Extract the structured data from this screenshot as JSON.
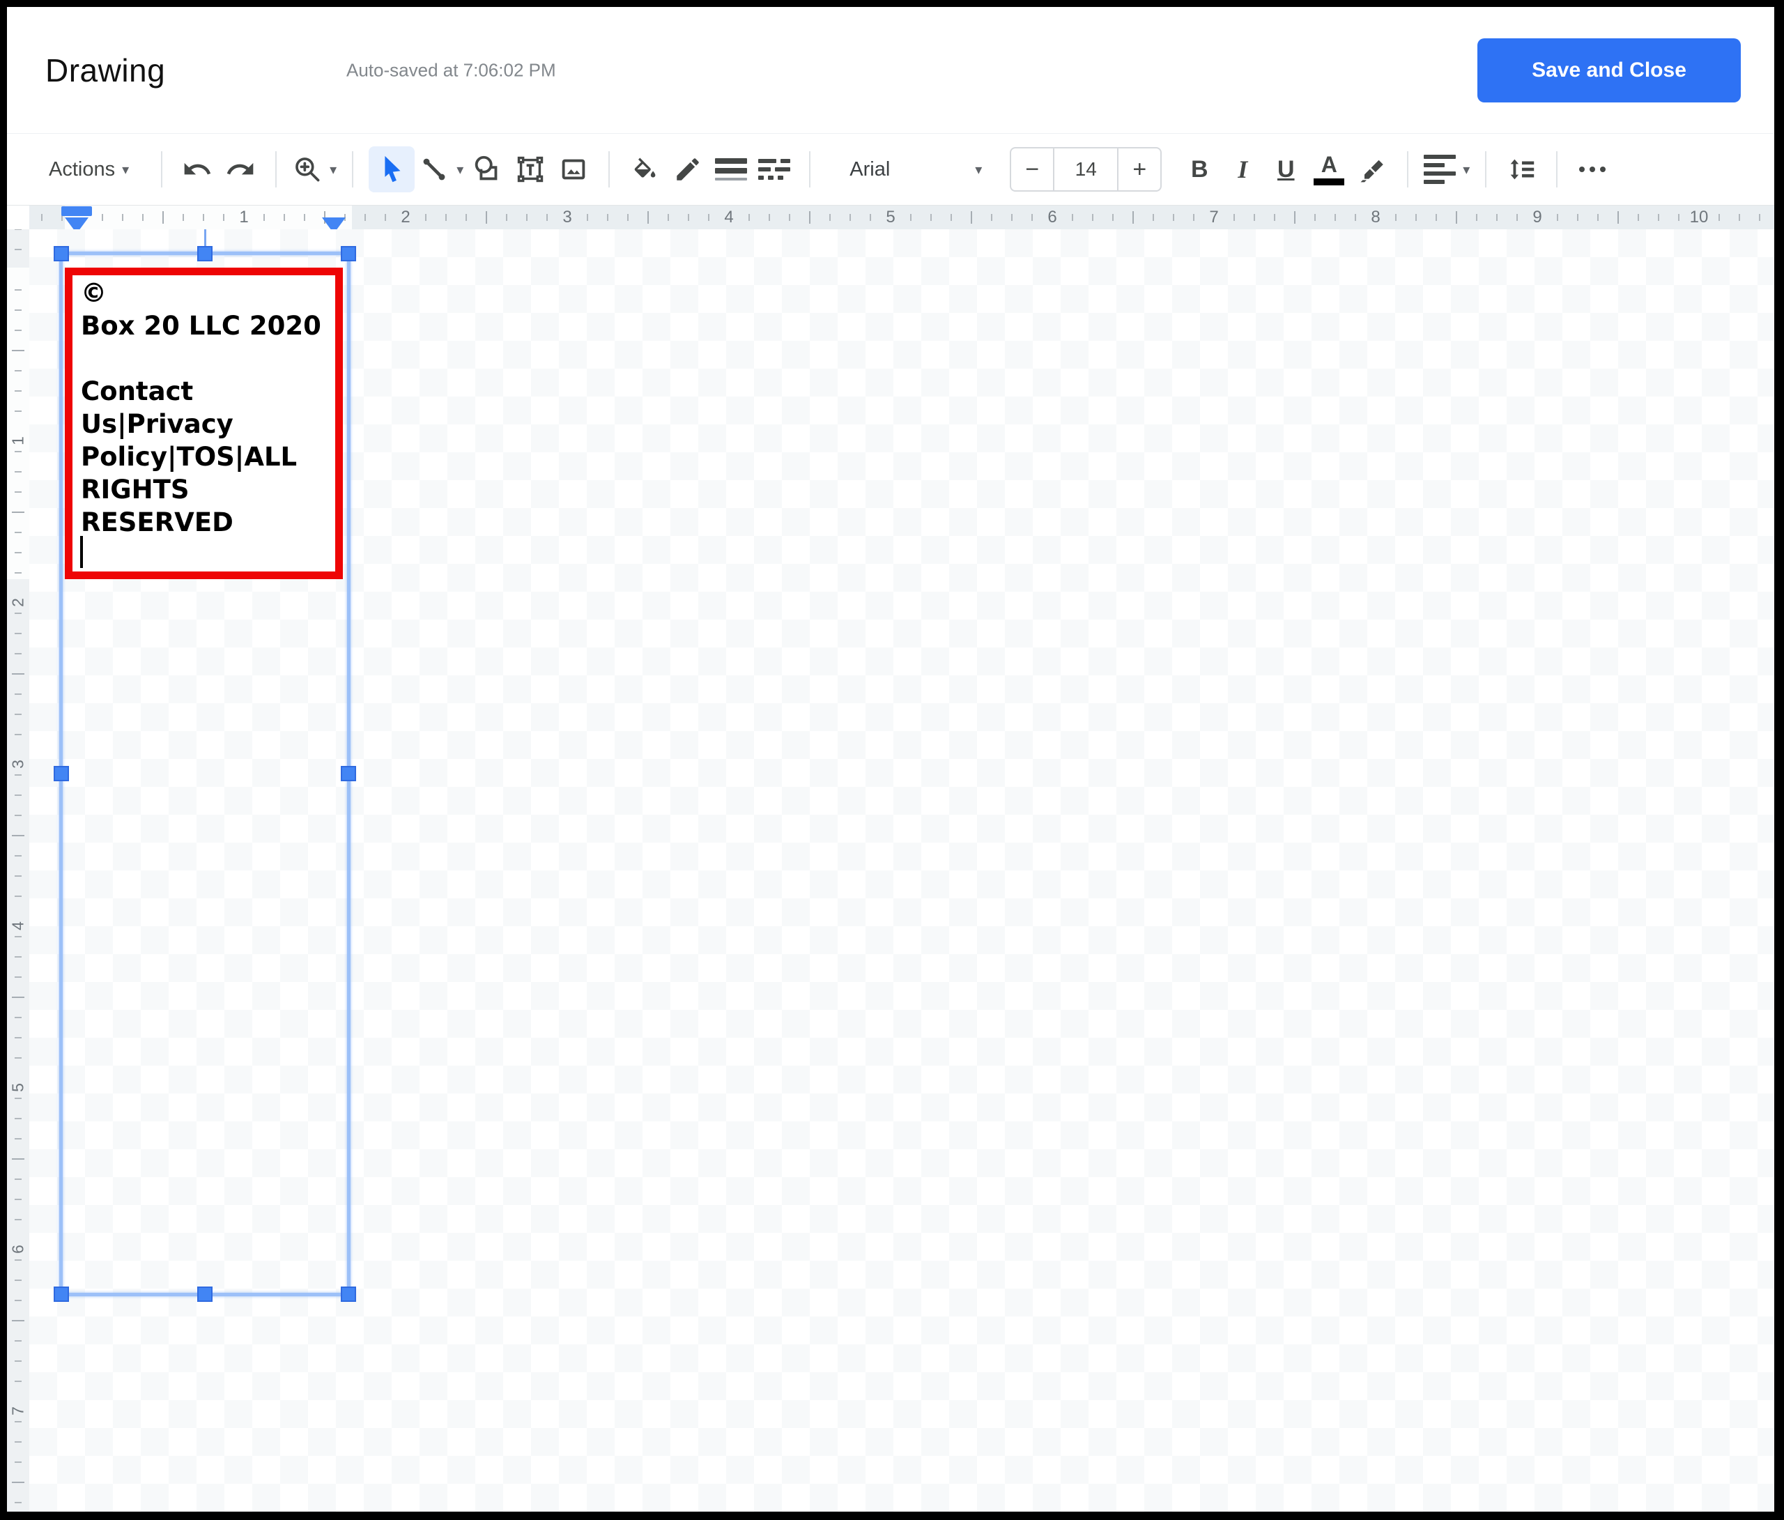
{
  "header": {
    "title": "Drawing",
    "autosave_status": "Auto-saved at 7:06:02 PM",
    "save_and_close_label": "Save and Close"
  },
  "toolbar": {
    "actions_label": "Actions",
    "caret": "▾",
    "font_name": "Arial",
    "font_size": "14",
    "decrease_label": "−",
    "increase_label": "+",
    "bold_label": "B",
    "italic_label": "I",
    "underline_label": "U",
    "text_color_label": "A"
  },
  "ruler": {
    "horizontal_numbers": [
      "1",
      "2",
      "3",
      "4",
      "5",
      "6",
      "7",
      "8",
      "9",
      "10"
    ],
    "vertical_numbers": [
      "1",
      "2",
      "3",
      "4",
      "5",
      "6",
      "7"
    ]
  },
  "canvas": {
    "textbox_text": "©\nBox 20 LLC 2020\n\nContact\nUs|Privacy\nPolicy|TOS|ALL\nRIGHTS\nRESERVED"
  },
  "icon_names": [
    "undo-icon",
    "redo-icon",
    "zoom-in-icon",
    "select-arrow-icon",
    "line-tool-icon",
    "shape-tool-icon",
    "text-box-tool-icon",
    "image-tool-icon",
    "fill-color-icon",
    "border-color-icon",
    "border-weight-icon",
    "border-dash-icon",
    "text-color-icon",
    "highlight-icon",
    "align-icon",
    "line-spacing-icon",
    "more-icon",
    "dropdown-caret-icon"
  ],
  "colors": {
    "accent_blue": "#2e72f4",
    "handle_blue": "#4285f4",
    "selection_blue": "#9cc0f8",
    "textbox_border_red": "#ee0505"
  }
}
